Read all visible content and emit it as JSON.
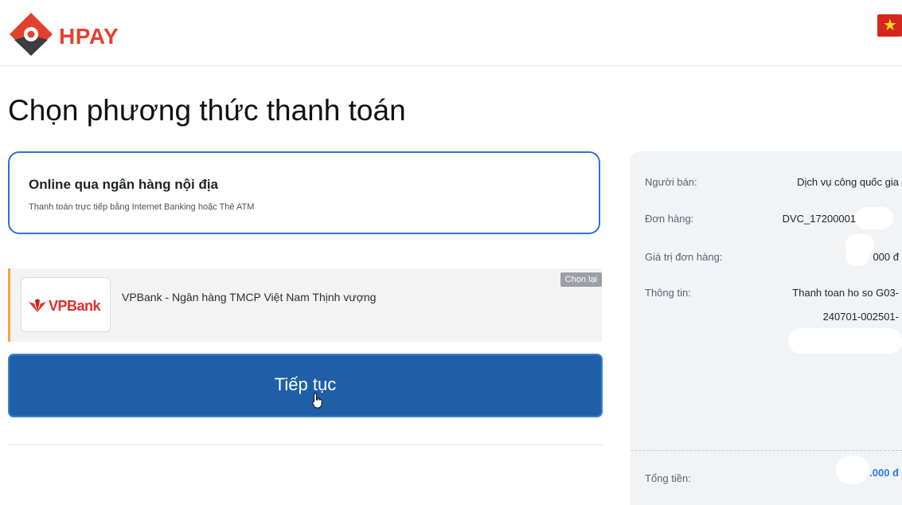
{
  "header": {
    "brand": "HPAY",
    "logo_icon": "hpay-logo-icon",
    "flag_icon": "vietnam-flag-icon",
    "flag_star": "★"
  },
  "page": {
    "title": "Chọn phương thức thanh toán"
  },
  "payment_method": {
    "title": "Online qua ngân hàng nội địa",
    "description": "Thanh toán trực tiếp bằng Internet Banking hoặc Thẻ ATM"
  },
  "bank": {
    "logo_text": "VPBank",
    "name": "VPBank - Ngân hàng TMCP Việt Nam Thịnh vượng",
    "reset_label": "Chọn lại"
  },
  "actions": {
    "continue_label": "Tiếp tục"
  },
  "summary": {
    "seller_label": "Người bán:",
    "seller_value": "Dịch vụ công quốc gia",
    "order_label": "Đơn hàng:",
    "order_value": "DVC_172000011;",
    "amount_label": "Giá trị đơn hàng:",
    "amount_value": "000 đ",
    "info_label": "Thông tin:",
    "info_line1": "Thanh toan ho so G03-",
    "info_line2": "240701-002501-",
    "total_label": "Tổng tiền:",
    "total_value": ".000 đ"
  },
  "colors": {
    "brand_red": "#e2412d",
    "primary_blue": "#1f5fa8",
    "border_blue": "#2f73c9",
    "accent_orange": "#f0a63b"
  }
}
